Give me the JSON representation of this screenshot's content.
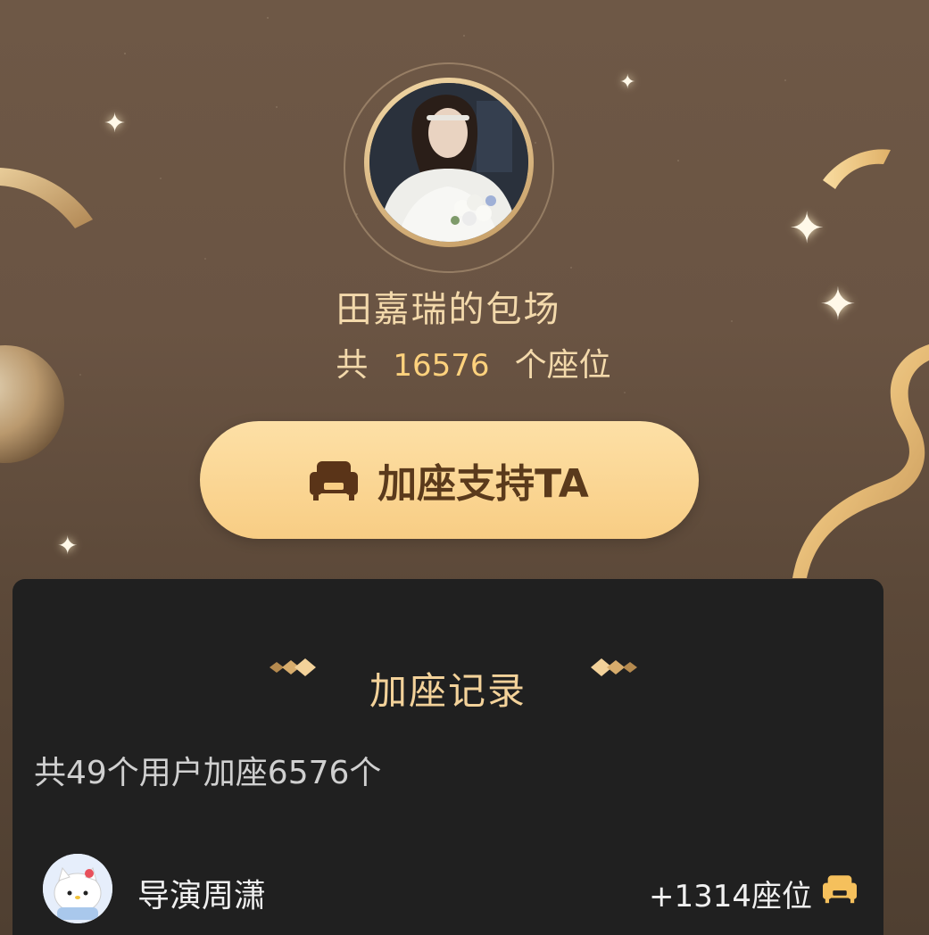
{
  "header": {
    "title": "田嘉瑞的包场",
    "seats_prefix": "共",
    "seats_count": "16576",
    "seats_suffix": "个座位"
  },
  "support_button": {
    "label": "加座支持TA",
    "icon": "sofa-icon"
  },
  "records": {
    "title": "加座记录",
    "summary": "共49个用户加座6576个",
    "items": [
      {
        "name": "导演周潇",
        "count": "+1314座位",
        "icon": "sofa-icon"
      }
    ]
  },
  "colors": {
    "background": "#6a5443",
    "accent_gold": "#f8cd84",
    "title_text": "#f3d9ab",
    "number_highlight": "#ffd27d",
    "panel_bg": "#202020"
  }
}
